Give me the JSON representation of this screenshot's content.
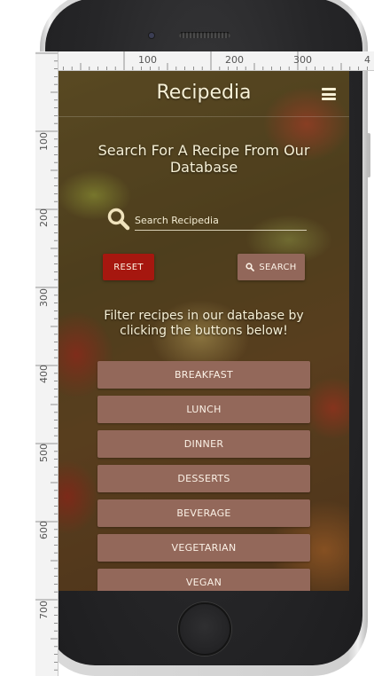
{
  "ruler": {
    "top_labels": [
      "100",
      "200",
      "300",
      "4"
    ],
    "left_labels": [
      "100",
      "200",
      "300",
      "400",
      "500",
      "600",
      "700"
    ]
  },
  "app": {
    "title": "Recipedia",
    "menu_icon": "hamburger-menu-icon"
  },
  "search": {
    "heading": "Search For A Recipe From Our Database",
    "placeholder": "Search Recipedia",
    "icon": "search-icon",
    "reset_label": "RESET",
    "search_label": "SEARCH"
  },
  "filter": {
    "text": "Filter recipes in our database by clicking the buttons below!",
    "buttons": [
      "BREAKFAST",
      "LUNCH",
      "DINNER",
      "DESSERTS",
      "BEVERAGE",
      "VEGETARIAN",
      "VEGAN"
    ]
  },
  "colors": {
    "accent_reset": "#a6170f",
    "button_brown": "#93685a",
    "text_cream": "#f6f0d6"
  }
}
